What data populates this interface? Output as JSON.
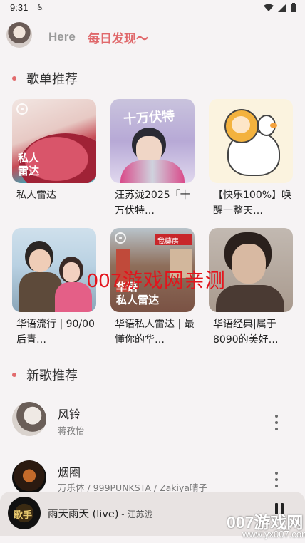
{
  "status_bar": {
    "time": "9:31",
    "icons": [
      "wifi-icon",
      "signal-icon",
      "battery-icon"
    ]
  },
  "header": {
    "greeting": "Here",
    "subtitle": "每日发现～"
  },
  "sections": {
    "playlists_title": "歌单推荐",
    "new_songs_title": "新歌推荐"
  },
  "playlists": [
    {
      "title": "私人雷达",
      "cover_label": "私人\n雷达"
    },
    {
      "title": "汪苏泷2025「十万伏特…",
      "cover_label": ""
    },
    {
      "title": "【快乐100%】唤醒一整天…",
      "cover_label": ""
    },
    {
      "title": "华语流行 | 90/00后青…",
      "cover_label": ""
    },
    {
      "title": "华语私人雷达 | 最懂你的华…",
      "cover_label": "华语\n私人雷达"
    },
    {
      "title": "华语经典|属于8090的美好…",
      "cover_label": ""
    }
  ],
  "watermark": "007游戏网亲测",
  "songs": [
    {
      "name": "风铃",
      "artist": "蒋孜怡"
    },
    {
      "name": "烟圈",
      "artist": "万乐体 / 999PUNKSTA / Zakiya晴子"
    }
  ],
  "player": {
    "title": "雨天雨天 (live)",
    "separator": " - ",
    "artist": "汪苏泷",
    "thumb_text": "歌手"
  },
  "site_watermark": {
    "main": "007游戏网",
    "sub": "www.yx007.com"
  },
  "colors": {
    "accent": "#e0686b",
    "background": "#f6f3f4"
  }
}
